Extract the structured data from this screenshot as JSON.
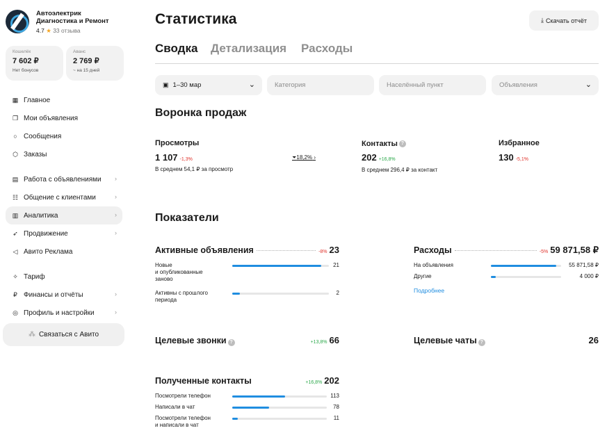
{
  "profile": {
    "name_line1": "Автоэлектрик",
    "name_line2": "Диагностика и Ремонт",
    "rating": "4.7",
    "reviews": "33 отзыва"
  },
  "wallets": [
    {
      "label": "Кошелёк",
      "value": "7 602 ₽",
      "sub": "Нет бонусов"
    },
    {
      "label": "Аванс",
      "value": "2 769 ₽",
      "sub": "~ на 15 дней"
    }
  ],
  "nav": [
    {
      "label": "Главное",
      "icon": "grid-icon",
      "chev": false
    },
    {
      "label": "Мои объявления",
      "icon": "pages-icon",
      "chev": false
    },
    {
      "label": "Сообщения",
      "icon": "chat-icon",
      "chev": false
    },
    {
      "label": "Заказы",
      "icon": "box-icon",
      "chev": false
    },
    {
      "label": "Работа с объявлениями",
      "icon": "edit-icon",
      "chev": true
    },
    {
      "label": "Общение с клиентами",
      "icon": "users-icon",
      "chev": true
    },
    {
      "label": "Аналитика",
      "icon": "chart-icon",
      "chev": true
    },
    {
      "label": "Продвижение",
      "icon": "rocket-icon",
      "chev": true
    },
    {
      "label": "Авито Реклама",
      "icon": "megaphone-icon",
      "chev": false
    },
    {
      "label": "Тариф",
      "icon": "tariff-icon",
      "chev": false
    },
    {
      "label": "Финансы и отчёты",
      "icon": "ruble-icon",
      "chev": true
    },
    {
      "label": "Профиль и настройки",
      "icon": "profile-icon",
      "chev": true
    }
  ],
  "contact_button": "Связаться с Авито",
  "header": {
    "title": "Статистика",
    "download": "Скачать отчёт"
  },
  "tabs": [
    "Сводка",
    "Детализация",
    "Расходы"
  ],
  "filters": {
    "period": "1–30 мар",
    "category": "Категория",
    "locality": "Населённый пункт",
    "ads": "Объявления"
  },
  "funnel": {
    "title": "Воронка продаж",
    "views": {
      "label": "Просмотры",
      "value": "1 107",
      "delta": "-1,3%",
      "sub": "В среднем 54,1 ₽ за просмотр"
    },
    "conversion": "18,2%",
    "contacts": {
      "label": "Контакты",
      "value": "202",
      "delta": "+16,8%",
      "sub": "В среднем 296,4 ₽ за контакт"
    },
    "favorites": {
      "label": "Избранное",
      "value": "130",
      "delta": "-5,1%"
    }
  },
  "indicators": {
    "title": "Показатели",
    "active_ads": {
      "label": "Активные объявления",
      "delta": "-8%",
      "value": "23",
      "rows": [
        {
          "label": "Новые\nи опубликованные\nзаново",
          "value": "21",
          "fraction": 0.92
        },
        {
          "label": "Активны с прошлого\nпериода",
          "value": "2",
          "fraction": 0.08
        }
      ]
    },
    "expenses": {
      "label": "Расходы",
      "delta": "-5%",
      "value": "59 871,58 ₽",
      "rows": [
        {
          "label": "На объявления",
          "value": "55 871,58 ₽",
          "fraction": 0.93
        },
        {
          "label": "Другие",
          "value": "4 000 ₽",
          "fraction": 0.07
        }
      ],
      "more": "Подробнее"
    },
    "target_calls": {
      "label": "Целевые звонки",
      "delta": "+13,8%",
      "value": "66"
    },
    "target_chats": {
      "label": "Целевые чаты",
      "value": "26"
    },
    "received_contacts": {
      "label": "Полученные контакты",
      "delta": "+16,8%",
      "value": "202",
      "rows": [
        {
          "label": "Посмотрели телефон",
          "value": "113",
          "fraction": 0.56
        },
        {
          "label": "Написали в чат",
          "value": "78",
          "fraction": 0.39
        },
        {
          "label": "Посмотрели телефон\nи написали в чат",
          "value": "11",
          "fraction": 0.06
        }
      ]
    }
  },
  "colors": {
    "accent": "#1f8de0",
    "negative": "#e0332c",
    "positive": "#2ba84a",
    "star": "#f5a623"
  }
}
